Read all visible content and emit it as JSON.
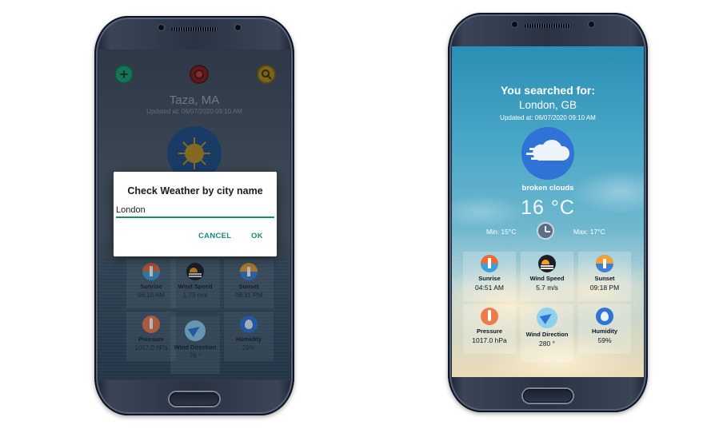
{
  "left_phone": {
    "city": "Taza, MA",
    "updated": "Updated at: 06/07/2020 09:10 AM",
    "dialog": {
      "title": "Check Weather by city name",
      "input_value": "London",
      "cancel_label": "CANCEL",
      "ok_label": "OK"
    },
    "tiles": [
      {
        "label": "Sunrise",
        "value": "06:10 AM"
      },
      {
        "label": "Wind Speed",
        "value": "1.73 m/s"
      },
      {
        "label": "Sunset",
        "value": "08:31 PM"
      },
      {
        "label": "Pressure",
        "value": "1017.0 hPa"
      },
      {
        "label": "Wind Direction",
        "value": "78 °"
      },
      {
        "label": "Humidity",
        "value": "29%"
      }
    ]
  },
  "right_phone": {
    "heading": "You searched for:",
    "city": "London, GB",
    "updated": "Updated at: 06/07/2020 09:10 AM",
    "description": "broken clouds",
    "temperature": "16 °C",
    "min": "Min: 15°C",
    "max": "Max: 17°C",
    "tiles": [
      {
        "label": "Sunrise",
        "value": "04:51 AM"
      },
      {
        "label": "Wind Speed",
        "value": "5.7 m/s"
      },
      {
        "label": "Sunset",
        "value": "09:18 PM"
      },
      {
        "label": "Pressure",
        "value": "1017.0 hPa"
      },
      {
        "label": "Wind Direction",
        "value": "280 °"
      },
      {
        "label": "Humidity",
        "value": "59%"
      }
    ]
  },
  "icons": {
    "add": "plus-icon",
    "location": "location-icon",
    "search": "search-icon",
    "weather_left": "sun-icon",
    "weather_right": "cloud-icon"
  },
  "colors": {
    "accent": "#1d8a7a",
    "weather_circle": "#2f73d6",
    "add_button": "#1c9e6e",
    "location_button": "#7d1c1c",
    "search_button": "#a88716"
  }
}
